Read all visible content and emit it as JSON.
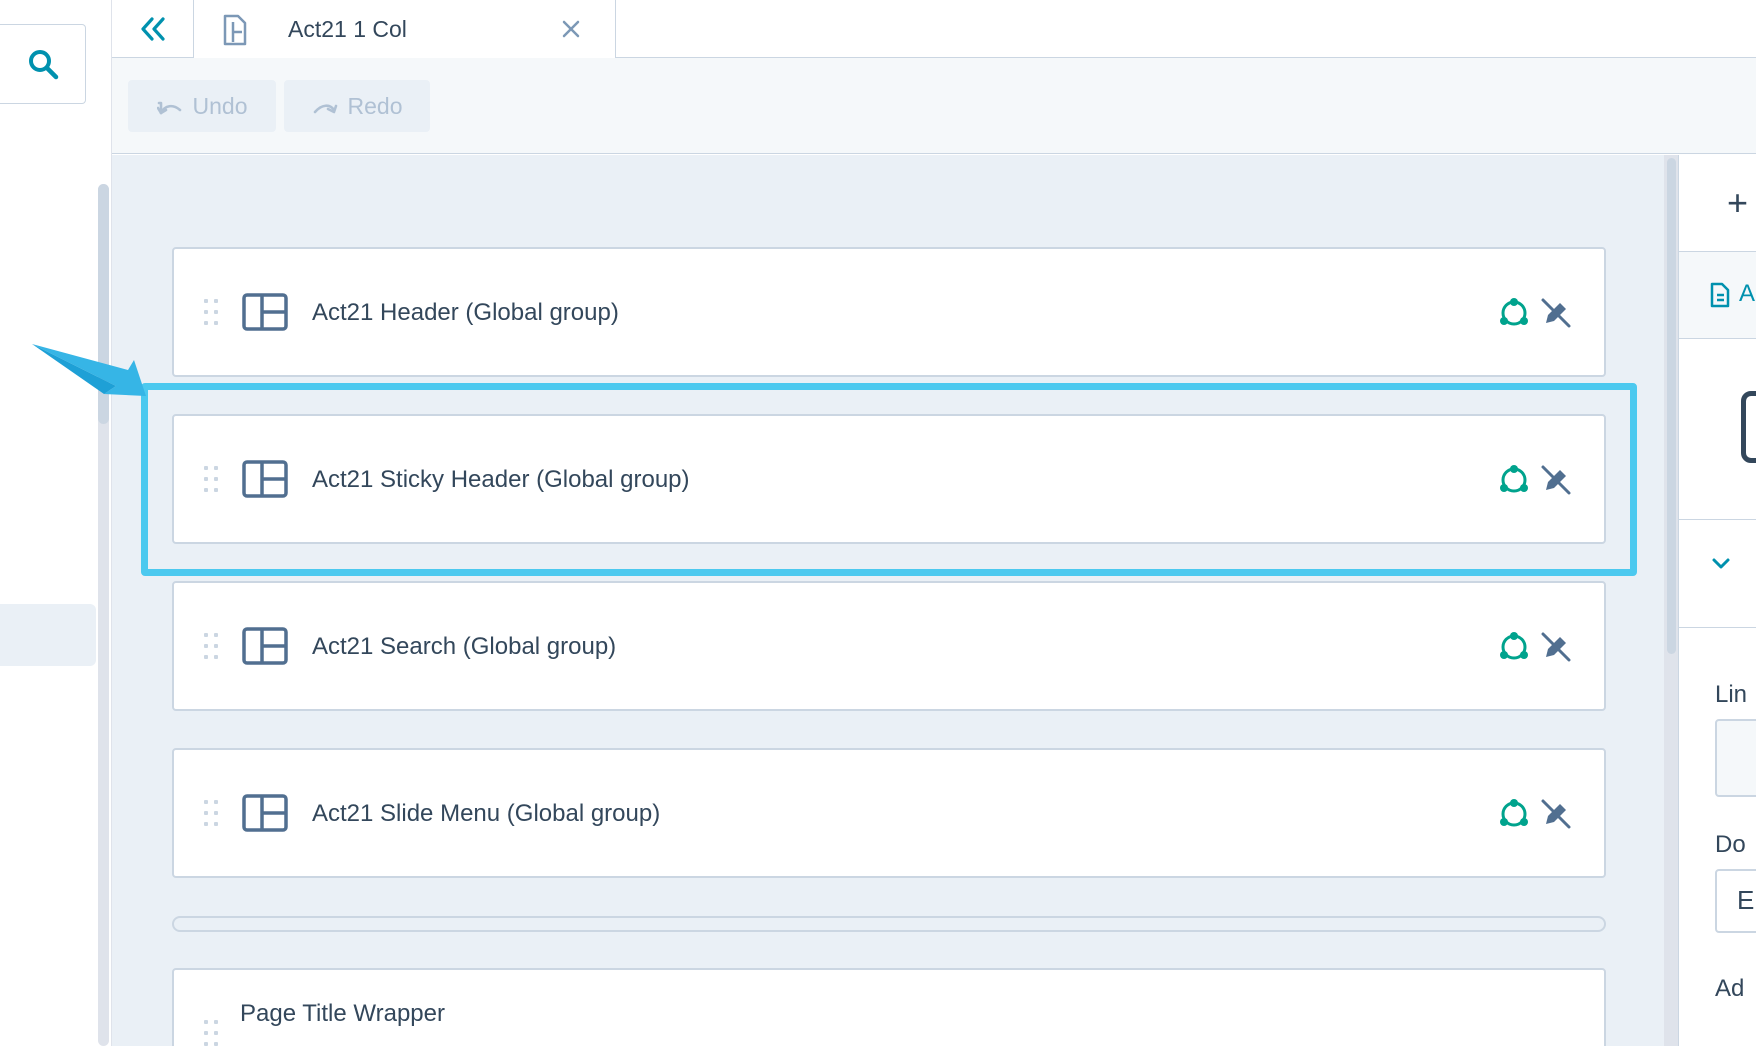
{
  "tab": {
    "title": "Act21 1 Col"
  },
  "toolbar": {
    "undo_label": "Undo",
    "redo_label": "Redo"
  },
  "modules": [
    {
      "label": "Act21 Header (Global group)"
    },
    {
      "label": "Act21 Sticky Header (Global group)"
    },
    {
      "label": "Act21 Search (Global group)"
    },
    {
      "label": "Act21 Slide Menu (Global group)"
    }
  ],
  "section": {
    "label": "Page Title Wrapper"
  },
  "right_panel": {
    "add_symbol": "+",
    "file_letter": "A",
    "label_1": "Lin",
    "label_2": "Do",
    "input_2_value": "E",
    "label_3": "Ad"
  },
  "colors": {
    "accent": "#0091ae",
    "highlight": "#4cc9ef",
    "global_icon": "#00a38d",
    "text": "#33475b"
  },
  "icons": {
    "search": "search-icon",
    "collapse": "double-chevron-left-icon",
    "document": "document-icon",
    "close": "close-icon",
    "undo": "undo-icon",
    "redo": "redo-icon",
    "layout": "layout-module-icon",
    "global": "global-group-icon",
    "unlink": "unlink-pen-icon"
  }
}
